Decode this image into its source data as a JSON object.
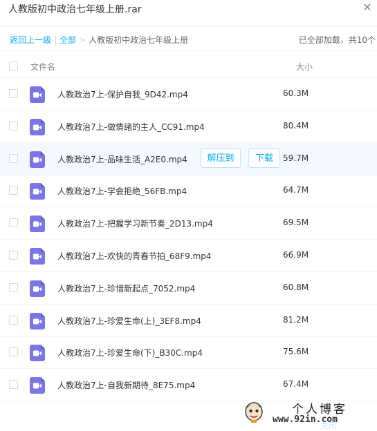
{
  "window": {
    "title": "人教版初中政治七年级上册.rar"
  },
  "breadcrumb": {
    "back": "返回上一级",
    "all": "全部",
    "current": "人教版初中政治七年级上册",
    "status": "已全部加载，共10个"
  },
  "table": {
    "headers": {
      "name": "文件名",
      "size": "大小"
    },
    "rows": [
      {
        "name": "人教政治7上-保护自我_9D42.mp4",
        "size": "60.3M"
      },
      {
        "name": "人教政治7上-做情绪的主人_CC91.mp4",
        "size": "80.4M"
      },
      {
        "name": "人教政治7上-品味生活_A2E0.mp4",
        "size": "59.7M"
      },
      {
        "name": "人教政治7上-学会拒绝_56FB.mp4",
        "size": "64.7M"
      },
      {
        "name": "人教政治7上-把握学习新节奏_2D13.mp4",
        "size": "69.5M"
      },
      {
        "name": "人教政治7上-欢快的青春节拍_68F9.mp4",
        "size": "66.9M"
      },
      {
        "name": "人教政治7上-珍惜新起点_7052.mp4",
        "size": "60.8M"
      },
      {
        "name": "人教政治7上-珍爱生命(上)_3EF8.mp4",
        "size": "81.2M"
      },
      {
        "name": "人教政治7上-珍爱生命(下)_B30C.mp4",
        "size": "75.6M"
      },
      {
        "name": "人教政治7上-自我新期待_8E75.mp4",
        "size": "67.4M"
      }
    ],
    "row_actions": {
      "extract": "解压到",
      "download": "下载"
    }
  },
  "icons": {
    "file": "video-file-icon",
    "close": "close-icon"
  },
  "colors": {
    "accent": "#09aaff",
    "file_icon": "#7b75e5",
    "hover_row": "#f3f9fe"
  },
  "watermark": {
    "title": "个人博客",
    "url": "www.92in.com",
    "faint": "关闭"
  }
}
